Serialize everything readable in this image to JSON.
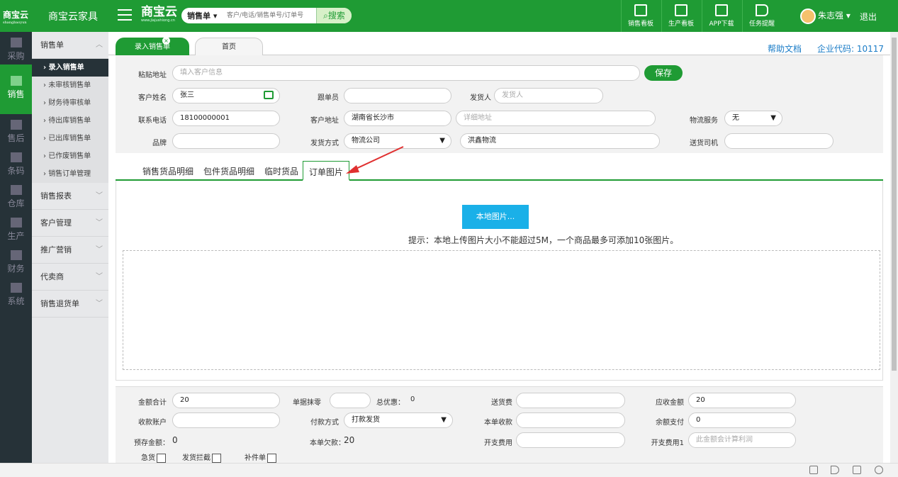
{
  "topbar": {
    "logo_text": "商宝云",
    "logo_sub": "shangbaoyun",
    "company_name": "商宝云家具",
    "brand": "商宝云",
    "brand_url": "www.jiajushiong.cn",
    "search_type": "销售单",
    "search_placeholder": "客户/电话/销售单号/订单号",
    "search_button": "搜索",
    "nav": [
      {
        "label": "销售看板",
        "icon": "chart-board-icon"
      },
      {
        "label": "生产看板",
        "icon": "chart-board-icon"
      },
      {
        "label": "APP下载",
        "icon": "qr-code-icon"
      },
      {
        "label": "任务提醒",
        "icon": "flag-icon"
      }
    ],
    "user_name": "朱志强",
    "logout": "退出"
  },
  "iconbar": [
    {
      "label": "采购",
      "icon": "cart-icon"
    },
    {
      "label": "销售",
      "icon": "sales-icon"
    },
    {
      "label": "售后",
      "icon": "after-sales-icon"
    },
    {
      "label": "条码",
      "icon": "barcode-icon"
    },
    {
      "label": "仓库",
      "icon": "warehouse-icon"
    },
    {
      "label": "生产",
      "icon": "robot-arm-icon"
    },
    {
      "label": "财务",
      "icon": "calculator-icon"
    },
    {
      "label": "系统",
      "icon": "gear-icon"
    }
  ],
  "sidebar": {
    "group_sales": "销售单",
    "sub_items": [
      "录入销售单",
      "未审核销售单",
      "财务待审核单",
      "待出库销售单",
      "已出库销售单",
      "已作废销售单",
      "销售订单管理"
    ],
    "groups": [
      "销售报表",
      "客户管理",
      "推广营销",
      "代卖商",
      "销售退货单"
    ]
  },
  "tabs": {
    "active": "录入销售单",
    "home": "首页",
    "help": "帮助文档",
    "company_code": "企业代码: 10117"
  },
  "form": {
    "paste_address_label": "粘贴地址",
    "paste_address_placeholder": "填入客户信息",
    "save_button": "保存",
    "customer_name_label": "客户姓名",
    "customer_name_value": "张三",
    "follower_label": "跟单员",
    "shipper_label": "发货人",
    "shipper_placeholder": "发货人",
    "phone_label": "联系电话",
    "phone_value": "18100000001",
    "address_label": "客户地址",
    "address_value": "湖南省长沙市",
    "address_detail_placeholder": "详细地址",
    "logistics_service_label": "物流服务",
    "logistics_service_value": "无",
    "brand_label": "品牌",
    "delivery_method_label": "发货方式",
    "delivery_method_value": "物流公司",
    "logistics_company_value": "洪鑫物流",
    "driver_label": "送货司机"
  },
  "subtabs": [
    "销售货品明细",
    "包件货品明细",
    "临时货品",
    "订单图片"
  ],
  "upload": {
    "button": "本地图片...",
    "hint": "提示：本地上传图片大小不能超过5M，一个商品最多可添加10张图片。"
  },
  "bottom": {
    "total_label": "金额合计",
    "total_value": "20",
    "rounding_label": "单据抹零",
    "total_discount_label": "总优惠：",
    "total_discount_value": "0",
    "delivery_fee_label": "送货费",
    "receivable_label": "应收金额",
    "receivable_value": "20",
    "account_label": "收款账户",
    "payment_method_label": "付款方式",
    "payment_method_value": "打款发货",
    "this_receipt_label": "本单收款",
    "balance_pay_label": "余额支付",
    "balance_pay_value": "0",
    "prepaid_label": "预存金额：",
    "prepaid_value": "0",
    "owed_label": "本单欠款：",
    "owed_value": "20",
    "expense_label": "开支费用",
    "expense1_label": "开支费用1",
    "expense1_placeholder": "此金额会计算利润",
    "urgent_label": "急货",
    "block_label": "发货拦截",
    "supplement_label": "补件单"
  }
}
